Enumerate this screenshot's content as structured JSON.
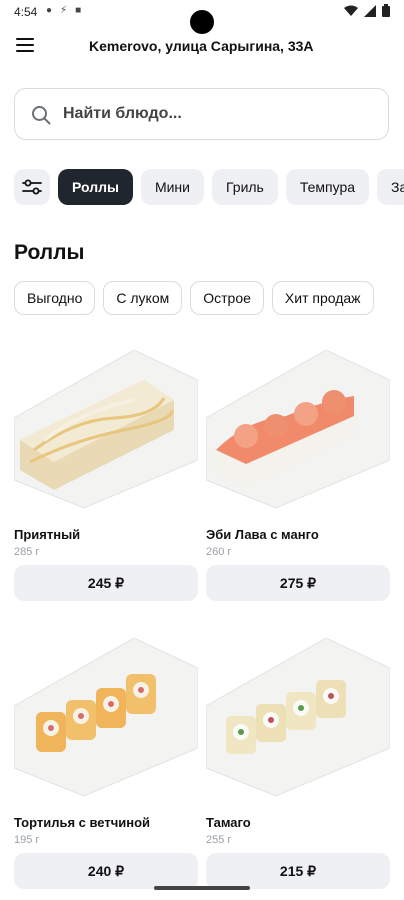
{
  "status_bar": {
    "time": "4:54"
  },
  "header": {
    "address": "Kemerovo, улица Сарыгина, 33А"
  },
  "search": {
    "placeholder": "Найти блюдо..."
  },
  "categories": [
    "Роллы",
    "Мини",
    "Гриль",
    "Темпура",
    "Заку"
  ],
  "section": {
    "title": "Роллы"
  },
  "tags": [
    "Выгодно",
    "С луком",
    "Острое",
    "Хит продаж"
  ],
  "products": [
    {
      "name": "Приятный",
      "weight": "285 г",
      "price": "245 ₽",
      "image": "cheese-sauce-roll-plate"
    },
    {
      "name": "Эби Лава с манго",
      "weight": "260 г",
      "price": "275 ₽",
      "image": "shrimp-lava-roll-plate"
    },
    {
      "name": "Тортилья с ветчиной",
      "weight": "195 г",
      "price": "240 ₽",
      "image": "tortilla-ham-roll-plate"
    },
    {
      "name": "Тамаго",
      "weight": "255 г",
      "price": "215 ₽",
      "image": "tamago-roll-plate"
    }
  ],
  "colors": {
    "accent_dark": "#20262e",
    "chip_bg": "#eef0f4",
    "border": "#d9dbe1",
    "muted_text": "#9aa0a8"
  },
  "icons": [
    "menu-icon",
    "search-icon",
    "filter-icon",
    "wifi-icon",
    "signal-icon",
    "battery-icon"
  ]
}
